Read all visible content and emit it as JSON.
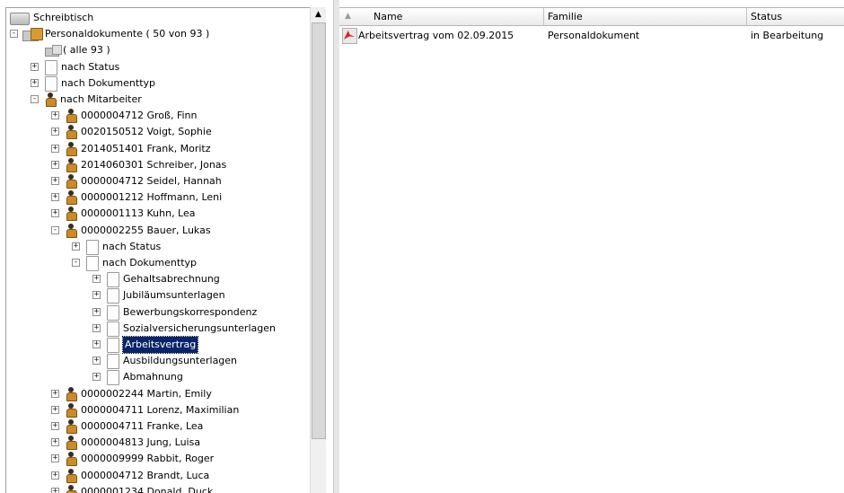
{
  "tree": {
    "root": {
      "label": "Schreibtisch"
    },
    "personal": {
      "label": "Personaldokumente ( 50 von 93 )"
    },
    "alle": {
      "label": "( alle 93 )"
    },
    "nach_status": {
      "label": "nach Status"
    },
    "nach_dokumenttyp": {
      "label": "nach Dokumenttyp"
    },
    "nach_mitarbeiter": {
      "label": "nach Mitarbeiter"
    },
    "employees_before": [
      "0000004712 Groß, Finn",
      "0020150512 Voigt, Sophie",
      "2014051401 Frank, Moritz",
      "2014060301 Schreiber, Jonas",
      "0000004712 Seidel, Hannah",
      "0000001212 Hoffmann, Leni",
      "0000001113 Kuhn, Lea"
    ],
    "expanded_employee": {
      "label": "0000002255 Bauer, Lukas"
    },
    "sub_nach_status": {
      "label": "nach Status"
    },
    "sub_nach_dokumenttyp": {
      "label": "nach Dokumenttyp"
    },
    "doctypes": [
      "Gehaltsabrechnung",
      "Jubiläumsunterlagen",
      "Bewerbungskorrespondenz",
      "Sozialversicherungsunterlagen",
      "Arbeitsvertrag",
      "Ausbildungsunterlagen",
      "Abmahnung"
    ],
    "selected_doctype": "Arbeitsvertrag",
    "employees_after": [
      "0000002244 Martin, Emily",
      "0000004711 Lorenz, Maximilian",
      "0000004711 Franke, Lea",
      "0000004813 Jung, Luisa",
      "0000009999 Rabbit, Roger",
      "0000004712 Brandt, Luca",
      "0000001234 Donald, Duck"
    ]
  },
  "list": {
    "columns": {
      "name": "Name",
      "familie": "Familie",
      "status": "Status"
    },
    "rows": [
      {
        "name": "Arbeitsvertrag vom 02.09.2015",
        "familie": "Personaldokument",
        "status": "in Bearbeitung",
        "icon": "pdf-icon"
      }
    ]
  },
  "colors": {
    "selection": "#0a246a",
    "pdf": "#d8231d"
  }
}
